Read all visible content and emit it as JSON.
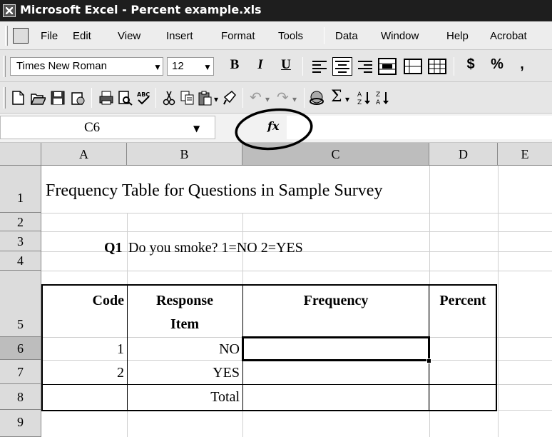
{
  "window": {
    "title": "Microsoft Excel - Percent example.xls"
  },
  "menu": [
    "File",
    "Edit",
    "View",
    "Insert",
    "Format",
    "Tools",
    "Data",
    "Window",
    "Help",
    "Acrobat"
  ],
  "format_toolbar": {
    "font": "Times New Roman",
    "size": "12",
    "bold": "B",
    "italic": "I",
    "underline": "U",
    "currency": "$",
    "percent": "%",
    "comma": ","
  },
  "formula_bar": {
    "name_box": "C6",
    "fx": "fx",
    "value": ""
  },
  "columns": [
    "A",
    "B",
    "C",
    "D",
    "E"
  ],
  "rows": [
    "1",
    "2",
    "3",
    "4",
    "5",
    "6",
    "7",
    "8",
    "9"
  ],
  "sheet": {
    "title": "Frequency Table for Questions in Sample Survey",
    "q_label": "Q1",
    "q_text": "Do you smoke? 1=NO  2=YES",
    "hdr_code": "Code",
    "hdr_response_1": "Response",
    "hdr_response_2": "Item",
    "hdr_frequency": "Frequency",
    "hdr_percent": "Percent",
    "r6_code": "1",
    "r6_item": "NO",
    "r7_code": "2",
    "r7_item": "YES",
    "r8_item": "Total"
  },
  "selected_cell": "C6",
  "annotation": "circle around fx button"
}
